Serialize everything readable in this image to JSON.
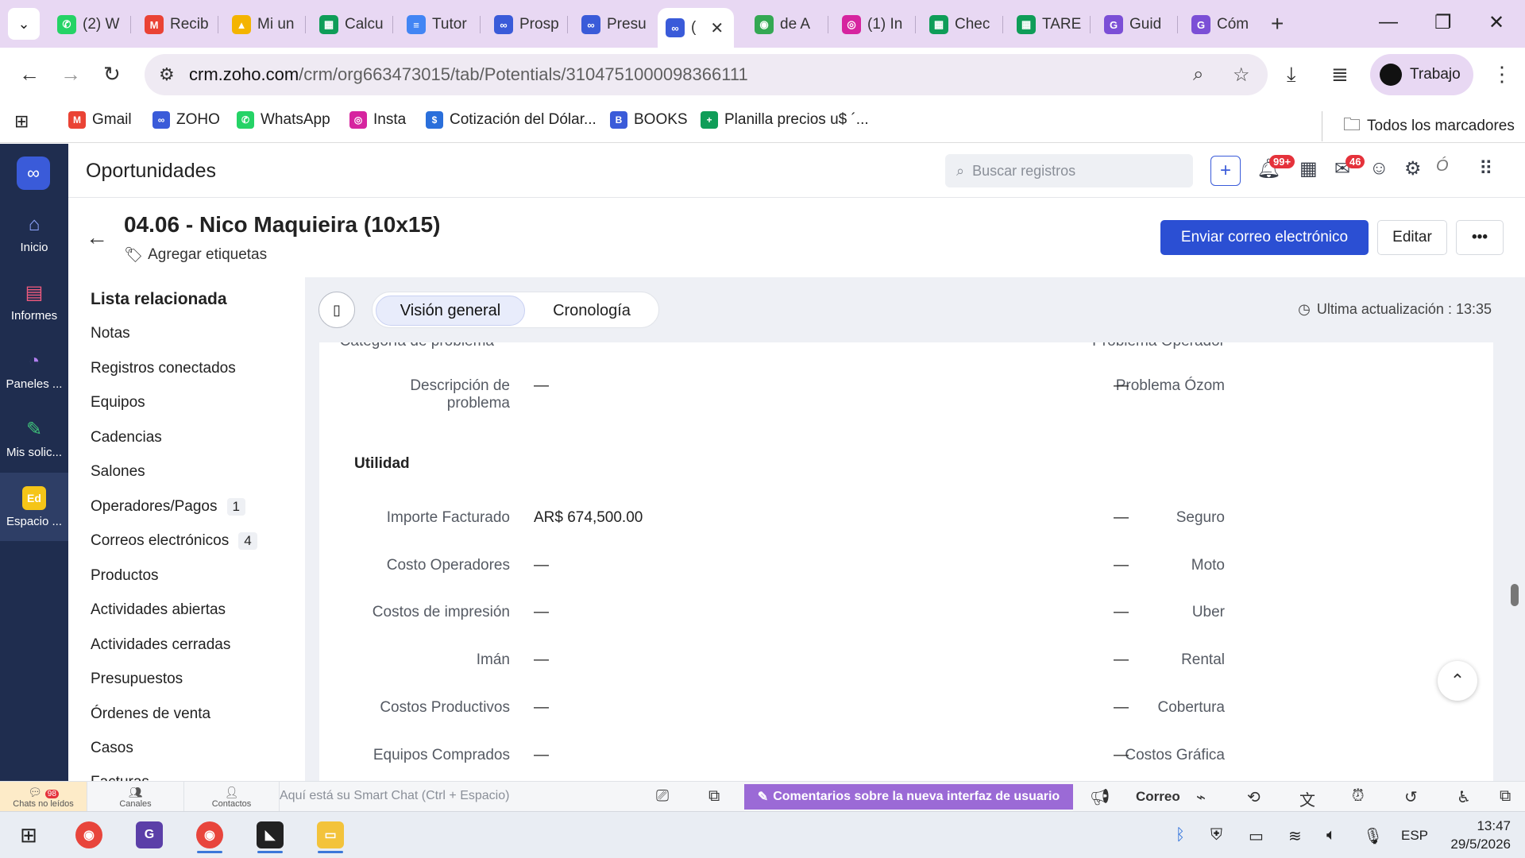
{
  "browser": {
    "tabs": [
      {
        "label": "(2) W",
        "icon": "whatsapp-icon",
        "color": "#25d366"
      },
      {
        "label": "Recib",
        "icon": "gmail-icon",
        "color": "#ea4335"
      },
      {
        "label": "Mi un",
        "icon": "drive-icon",
        "color": "#f4b400"
      },
      {
        "label": "Calcu",
        "icon": "sheets-icon",
        "color": "#0f9d58"
      },
      {
        "label": "Tutor",
        "icon": "docs-icon",
        "color": "#4285f4"
      },
      {
        "label": "Prosp",
        "icon": "zoho-crm-icon",
        "color": "#3a5bd9"
      },
      {
        "label": "Presu",
        "icon": "zoho-crm-icon",
        "color": "#3a5bd9"
      },
      {
        "label": "(",
        "icon": "zoho-crm-icon",
        "color": "#3a5bd9"
      },
      {
        "label": "de A",
        "icon": "maps-icon",
        "color": "#34a853"
      },
      {
        "label": "(1) In",
        "icon": "instagram-icon",
        "color": "#d6249f"
      },
      {
        "label": "Chec",
        "icon": "sheets-icon",
        "color": "#0f9d58"
      },
      {
        "label": "TARE",
        "icon": "sheets-icon",
        "color": "#0f9d58"
      },
      {
        "label": "Guid",
        "icon": "g-icon",
        "color": "#7b4fd6"
      },
      {
        "label": "Cóm",
        "icon": "g-icon",
        "color": "#7b4fd6"
      }
    ],
    "url_host": "crm.zoho.com",
    "url_path": "/crm/org663473015/tab/Potentials/3104751000098366111",
    "profile_label": "Trabajo",
    "bookmarks": [
      {
        "label": "Gmail",
        "icon": "gmail-icon",
        "color": "#ea4335"
      },
      {
        "label": "ZOHO",
        "icon": "zoho-icon",
        "color": "#3a5bd9"
      },
      {
        "label": "WhatsApp",
        "icon": "whatsapp-icon",
        "color": "#25d366"
      },
      {
        "label": "Insta",
        "icon": "instagram-icon",
        "color": "#d6249f"
      },
      {
        "label": "Cotización del Dólar...",
        "icon": "dolar-icon",
        "color": "#2a6fdb"
      },
      {
        "label": "BOOKS",
        "icon": "books-icon",
        "color": "#3a5bd9"
      },
      {
        "label": "Planilla precios u$ ´...",
        "icon": "sheets-icon",
        "color": "#0f9d58"
      }
    ],
    "all_bookmarks_label": "Todos los marcadores"
  },
  "rail": {
    "items": [
      {
        "label": "Inicio",
        "icon": "home-icon"
      },
      {
        "label": "Informes",
        "icon": "reports-icon"
      },
      {
        "label": "Paneles ...",
        "icon": "dashboards-icon"
      },
      {
        "label": "Mis solic...",
        "icon": "requests-icon"
      },
      {
        "label": "Espacio ...",
        "icon": "workspace-icon",
        "badge": "Ed"
      }
    ]
  },
  "header": {
    "module": "Oportunidades",
    "search_placeholder": "Buscar registros",
    "notif_badge": "99+",
    "mail_badge": "46"
  },
  "record": {
    "title": "04.06 - Nico Maquieira (10x15)",
    "tags_label": "Agregar etiquetas",
    "send_email": "Enviar correo electrónico",
    "edit": "Editar",
    "more": "•••"
  },
  "related": {
    "title": "Lista relacionada",
    "items": [
      {
        "label": "Notas",
        "count": ""
      },
      {
        "label": "Registros conectados",
        "count": ""
      },
      {
        "label": "Equipos",
        "count": ""
      },
      {
        "label": "Cadencias",
        "count": ""
      },
      {
        "label": "Salones",
        "count": ""
      },
      {
        "label": "Operadores/Pagos",
        "count": "1"
      },
      {
        "label": "Correos electrónicos",
        "count": "4"
      },
      {
        "label": "Productos",
        "count": ""
      },
      {
        "label": "Actividades abiertas",
        "count": ""
      },
      {
        "label": "Actividades cerradas",
        "count": ""
      },
      {
        "label": "Presupuestos",
        "count": ""
      },
      {
        "label": "Órdenes de venta",
        "count": ""
      },
      {
        "label": "Casos",
        "count": ""
      },
      {
        "label": "Facturas",
        "count": ""
      }
    ]
  },
  "overview": {
    "tab_overview": "Visión general",
    "tab_timeline": "Cronología",
    "last_update": "Ultima actualización : 13:35"
  },
  "fields": {
    "top_partial_left": {
      "label": "Categoría de problema",
      "value": "—"
    },
    "top_partial_right": {
      "label": "Problema Operador",
      "value": "—"
    },
    "desc_left": {
      "label_l1": "Descripción de",
      "label_l2": "problema",
      "value": "—"
    },
    "desc_right": {
      "label": "Problema Ózom",
      "value": "—"
    },
    "section": "Utilidad",
    "rows": [
      {
        "left_label": "Importe Facturado",
        "left_value": "AR$ 674,500.00",
        "right_label": "Seguro",
        "right_value": "—"
      },
      {
        "left_label": "Costo Operadores",
        "left_value": "—",
        "right_label": "Moto",
        "right_value": "—"
      },
      {
        "left_label": "Costos de impresión",
        "left_value": "—",
        "right_label": "Uber",
        "right_value": "—"
      },
      {
        "left_label": "Imán",
        "left_value": "—",
        "right_label": "Rental",
        "right_value": "—"
      },
      {
        "left_label": "Costos Productivos",
        "left_value": "—",
        "right_label": "Cobertura",
        "right_value": "—"
      },
      {
        "left_label": "Equipos Comprados",
        "left_value": "—",
        "right_label": "Costos Gráfica",
        "right_value": "—"
      }
    ]
  },
  "smartbar": {
    "chats_label": "Chats no leídos",
    "chats_badge": "98",
    "channels_label": "Canales",
    "contacts_label": "Contactos",
    "input_placeholder": "Aquí está su Smart Chat (Ctrl + Espacio)",
    "feedback_label": "Comentarios sobre la nueva interfaz de usuario",
    "mail_label": "Correo"
  },
  "taskbar": {
    "lang": "ESP",
    "time": "13:47",
    "date": "29/5/2026"
  }
}
